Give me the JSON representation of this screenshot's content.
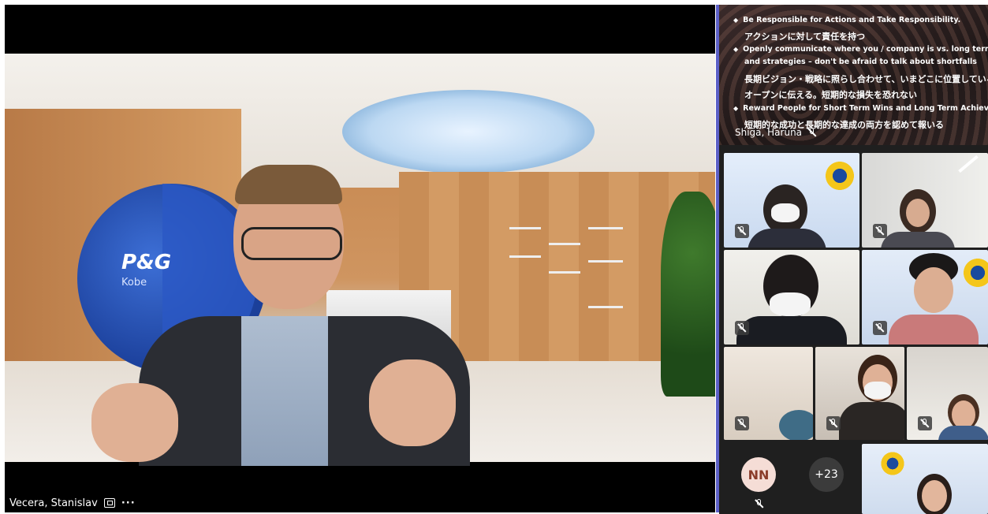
{
  "main_speaker": {
    "name": "Vecera, Stanislav",
    "more_label": "···",
    "logo_text": "P&G",
    "logo_sub": "Kobe"
  },
  "slide": {
    "bullets": [
      {
        "en": "Be Responsible for Actions and Take Responsibility.",
        "jp": "アクションに対して責任を持つ"
      },
      {
        "en": "Openly communicate where you / company is vs. long term Vision",
        "en2": "and strategies – don't be afraid to talk about shortfalls",
        "jp": "長期ビジョン・戦略に照らし合わせて、いまどこに位置しているのかを",
        "jp2": "オープンに伝える。短期的な損失を恐れない"
      },
      {
        "en": "Reward People for Short Term Wins and Long Term Achievements.",
        "jp": "短期的な成功と長期的な達成の両方を認めて報いる"
      }
    ],
    "presenter": "Shiga, Haruna"
  },
  "participants": {
    "avatar_initials": "NN",
    "overflow_count": "+23"
  },
  "colors": {
    "accent": "#5b5fc7",
    "avatar_bg": "#f5ddd6",
    "avatar_fg": "#8a3c2a",
    "badge_bg": "#3b3b3b"
  }
}
